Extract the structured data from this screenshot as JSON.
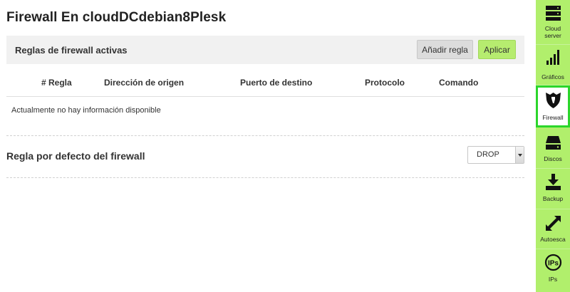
{
  "page": {
    "title": "Firewall En cloudDCdebian8Plesk"
  },
  "rules_panel": {
    "title": "Reglas de firewall activas",
    "add_rule_label": "Añadir regla",
    "apply_label": "Aplicar",
    "columns": [
      "# Regla",
      "Dirección de origen",
      "Puerto de destino",
      "Protocolo",
      "Comando"
    ],
    "empty_message": "Actualmente no hay información disponible"
  },
  "default_rule": {
    "title": "Regla por defecto del firewall",
    "selected_value": "DROP"
  },
  "sidebar": {
    "items": [
      {
        "label_line1": "Cloud",
        "label_line2": "server",
        "icon": "server-icon"
      },
      {
        "label_line1": "Gráficos",
        "label_line2": "",
        "icon": "bar-chart-icon"
      },
      {
        "label_line1": "Firewall",
        "label_line2": "",
        "icon": "shield-icon",
        "active": true
      },
      {
        "label_line1": "Discos",
        "label_line2": "",
        "icon": "disk-icon"
      },
      {
        "label_line1": "Backup",
        "label_line2": "",
        "icon": "download-icon"
      },
      {
        "label_line1": "Autoesca",
        "label_line2": "",
        "icon": "resize-arrows-icon"
      },
      {
        "label_line1": "IPs",
        "label_line2": "",
        "icon": "ips-icon"
      }
    ]
  },
  "colors": {
    "sidebar_bg": "#b1ef6c",
    "active_border": "#2bd62b",
    "apply_button": "#b6ec6f"
  }
}
